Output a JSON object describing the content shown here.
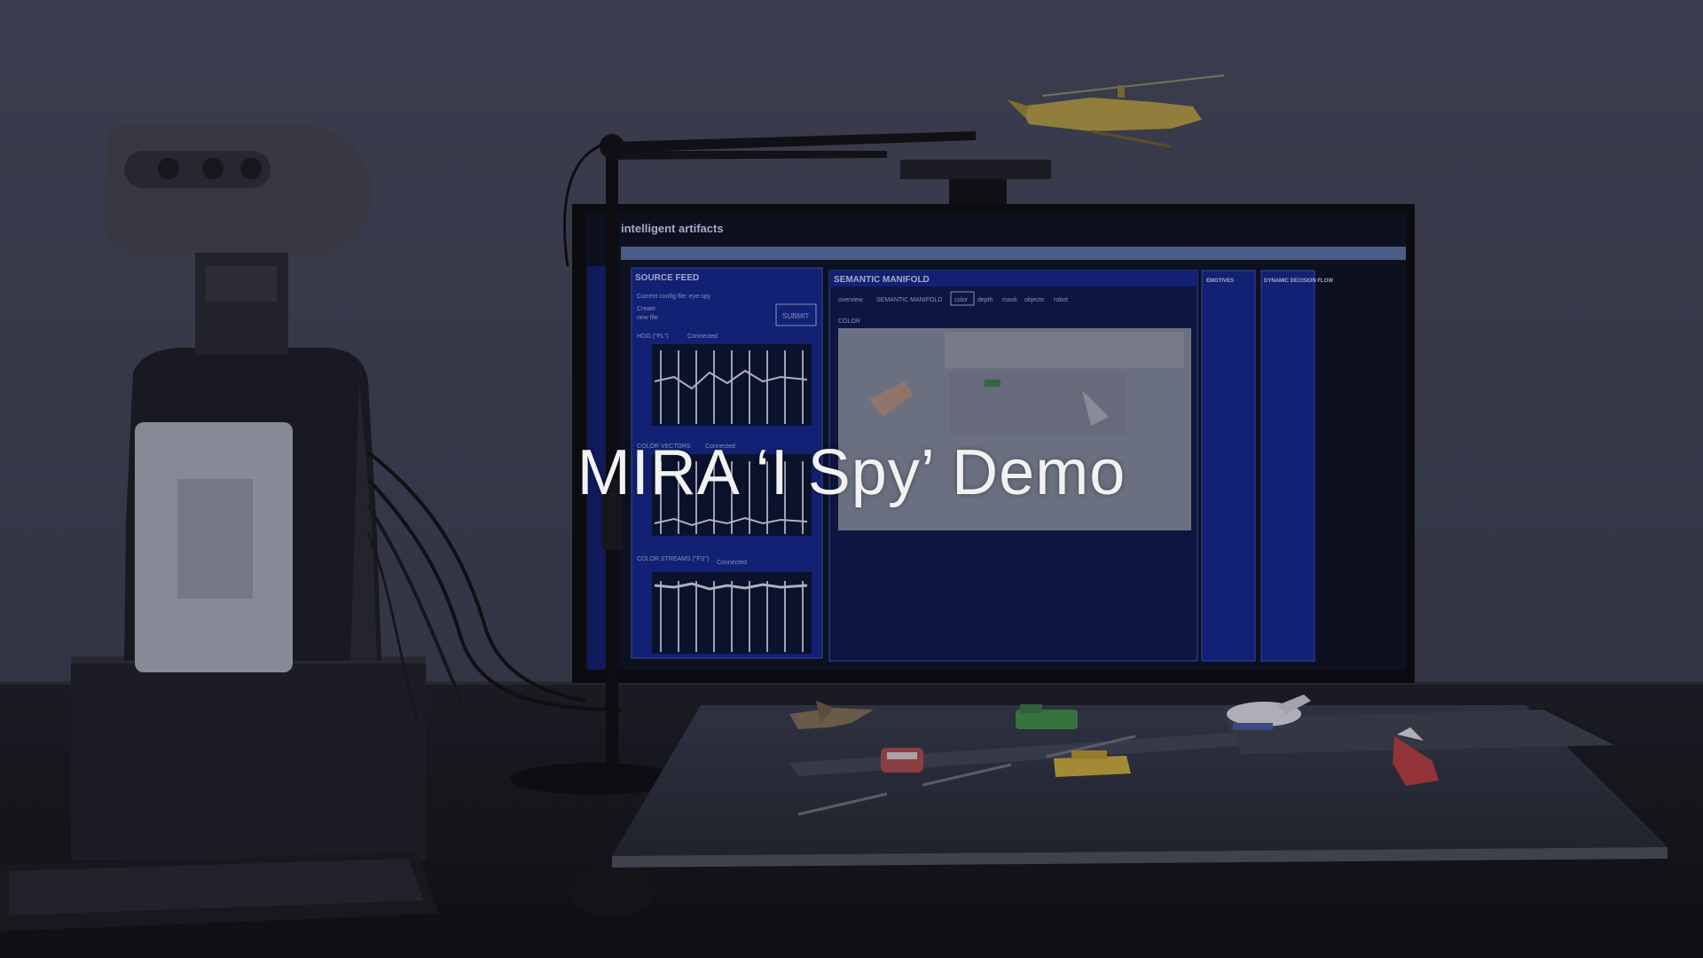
{
  "video": {
    "title": "MIRA ‘I Spy’ Demo"
  },
  "monitor_ui": {
    "brand": "intelligent artifacts",
    "panels": {
      "source_feed": {
        "header": "SOURCE FEED",
        "config_label": "Current config file: eye-spy",
        "create_label": "Create",
        "new_file_label": "new file",
        "submit_label": "SUBMIT",
        "graphs": [
          {
            "label": "HOG (\"FL\")",
            "status": "Connected"
          },
          {
            "label": "COLOR VECTORS",
            "status": "Connected"
          },
          {
            "label": "COLOR STREAMS (\"FS\")",
            "status": "Connected"
          }
        ]
      },
      "semantic_manifold": {
        "header": "SEMANTIC MANIFOLD",
        "tabs": [
          "overview",
          "SEMANTIC MANIFOLD",
          "color",
          "depth",
          "mask",
          "objects",
          "robot"
        ],
        "active_tab": "color",
        "view_label": "COLOR"
      },
      "emotives": {
        "header": "EMOTIVES"
      },
      "decision_flow": {
        "header": "DYNAMIC DECISION FLOW"
      }
    }
  },
  "colors": {
    "background_wall": "#3e4153",
    "desk": "#131419",
    "monitor_ui_blue": "#10238a",
    "title_text": "#f2f2f2",
    "toy_helicopter": "#b29a45"
  }
}
